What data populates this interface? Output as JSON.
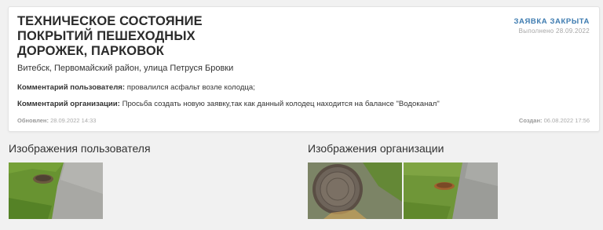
{
  "request": {
    "title": "ТЕХНИЧЕСКОЕ СОСТОЯНИЕ\nПОКРЫТИЙ ПЕШЕХОДНЫХ\nДОРОЖЕК, ПАРКОВОК",
    "status": "ЗАЯВКА ЗАКРЫТА",
    "status_detail": "Выполнено 28.09.2022",
    "address": "Витебск, Первомайский район, улица Петруся Бровки",
    "user_comment_label": "Комментарий пользователя:",
    "user_comment": "провалился асфальт возле колодца;",
    "org_comment_label": "Комментарий организации:",
    "org_comment": "Просьба создать новую заявку,так как данный колодец находится на балансе \"Водоканал\"",
    "updated_label": "Обновлен:",
    "updated_value": "28.09.2022 14:33",
    "created_label": "Создан:",
    "created_value": "06.08.2022 17:56",
    "status_color": "#3d7bb0"
  },
  "images": {
    "user_title": "Изображения пользователя",
    "org_title": "Изображения организации",
    "user_count": 1,
    "org_count": 2
  }
}
